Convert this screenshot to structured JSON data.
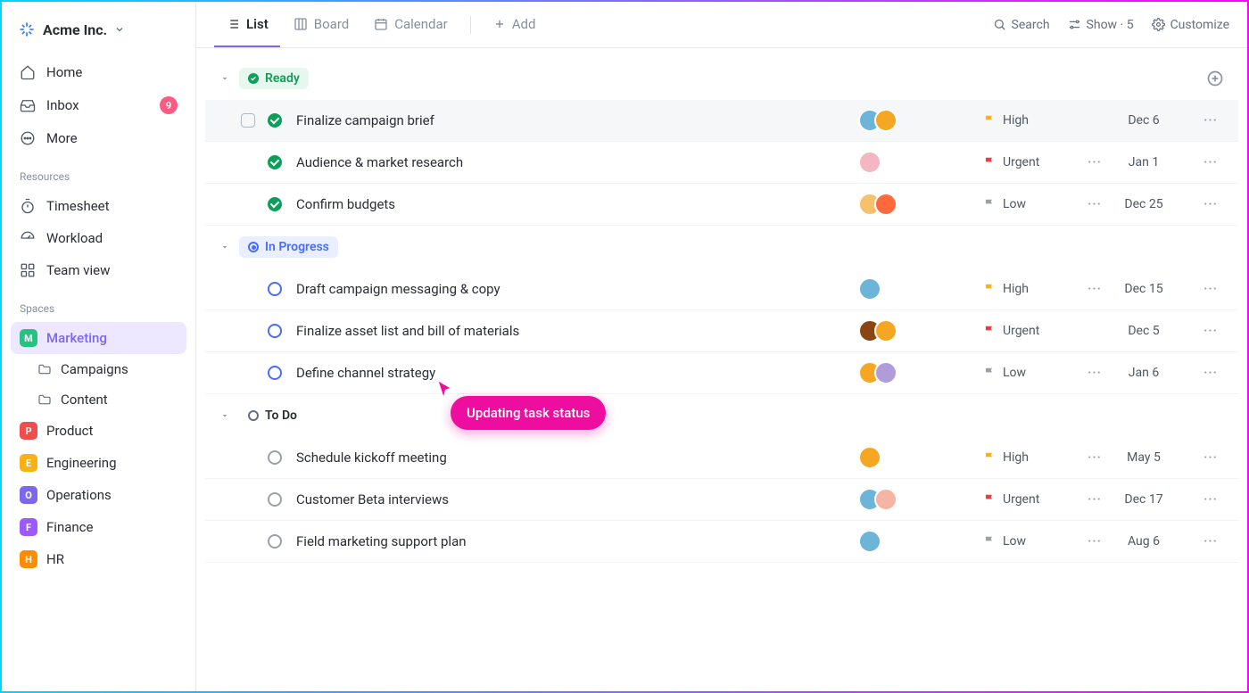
{
  "workspace": {
    "name": "Acme Inc."
  },
  "nav": {
    "home": "Home",
    "inbox": "Inbox",
    "inbox_badge": "9",
    "more": "More"
  },
  "resources": {
    "label": "Resources",
    "timesheet": "Timesheet",
    "workload": "Workload",
    "teamview": "Team view"
  },
  "spaces": {
    "label": "Spaces",
    "items": [
      {
        "initial": "M",
        "label": "Marketing",
        "color": "#26c281",
        "active": true
      },
      {
        "initial": "P",
        "label": "Product",
        "color": "#f14d4d"
      },
      {
        "initial": "E",
        "label": "Engineering",
        "color": "#f9b117"
      },
      {
        "initial": "O",
        "label": "Operations",
        "color": "#7b68ee"
      },
      {
        "initial": "F",
        "label": "Finance",
        "color": "#9b59ff"
      },
      {
        "initial": "H",
        "label": "HR",
        "color": "#ff8b00"
      }
    ],
    "folders": {
      "campaigns": "Campaigns",
      "content": "Content"
    }
  },
  "views": {
    "list": "List",
    "board": "Board",
    "calendar": "Calendar",
    "add": "Add"
  },
  "toolbar": {
    "search": "Search",
    "show": "Show",
    "show_count": "5",
    "customize": "Customize"
  },
  "groups": [
    {
      "key": "ready",
      "label": "Ready",
      "style": "ready",
      "show_add": true,
      "tasks": [
        {
          "title": "Finalize campaign brief",
          "status": "done",
          "assignees": [
            "#6cb5d9",
            "#f5a623"
          ],
          "priority": "High",
          "flag": "#f9b117",
          "subtasks": false,
          "due": "Dec 6",
          "highlight": true,
          "checkbox": true
        },
        {
          "title": "Audience & market research",
          "status": "done",
          "assignees": [
            "#f4b6c2"
          ],
          "priority": "Urgent",
          "flag": "#ee3b3b",
          "subtasks": true,
          "due": "Jan 1"
        },
        {
          "title": "Confirm budgets",
          "status": "done",
          "assignees": [
            "#f5c26b",
            "#ff6a3d"
          ],
          "priority": "Low",
          "flag": "#9aa0aa",
          "subtasks": true,
          "due": "Dec 25"
        }
      ]
    },
    {
      "key": "progress",
      "label": "In Progress",
      "style": "progress",
      "tasks": [
        {
          "title": "Draft campaign messaging & copy",
          "status": "open",
          "assignees": [
            "#6cb5d9"
          ],
          "priority": "High",
          "flag": "#f9b117",
          "subtasks": true,
          "due": "Dec 15"
        },
        {
          "title": "Finalize asset list and bill of materials",
          "status": "open",
          "assignees": [
            "#8b4513",
            "#f5a623"
          ],
          "priority": "Urgent",
          "flag": "#ee3b3b",
          "subtasks": false,
          "due": "Dec 5"
        },
        {
          "title": "Define channel strategy",
          "status": "open",
          "assignees": [
            "#f5a623",
            "#b19cd9"
          ],
          "priority": "Low",
          "flag": "#9aa0aa",
          "subtasks": true,
          "due": "Jan 6"
        }
      ]
    },
    {
      "key": "todo",
      "label": "To Do",
      "style": "todo",
      "tasks": [
        {
          "title": "Schedule kickoff meeting",
          "status": "todo",
          "assignees": [
            "#f5a623"
          ],
          "priority": "High",
          "flag": "#f9b117",
          "subtasks": true,
          "due": "May 5"
        },
        {
          "title": "Customer Beta interviews",
          "status": "todo",
          "assignees": [
            "#6cb5d9",
            "#f4b6a2"
          ],
          "priority": "Urgent",
          "flag": "#ee3b3b",
          "subtasks": true,
          "due": "Dec 17"
        },
        {
          "title": "Field marketing support plan",
          "status": "todo",
          "assignees": [
            "#6cb5d9"
          ],
          "priority": "Low",
          "flag": "#9aa0aa",
          "subtasks": true,
          "due": "Aug 6"
        }
      ]
    }
  ],
  "tooltip": "Updating task status"
}
